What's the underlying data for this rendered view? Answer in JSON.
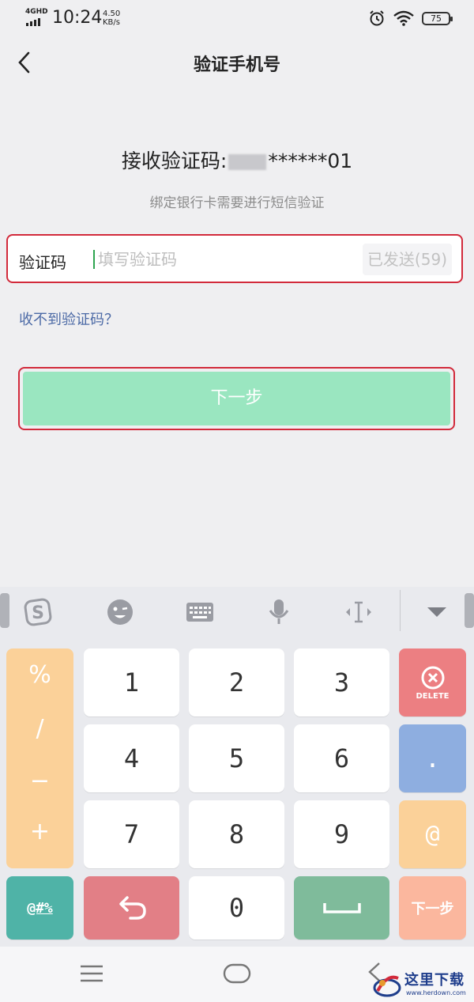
{
  "status_bar": {
    "network": "4GHD",
    "time": "10:24",
    "speed_value": "4.50",
    "speed_unit": "KB/s",
    "battery": "75"
  },
  "nav": {
    "title": "验证手机号"
  },
  "main": {
    "receive_label": "接收验证码:",
    "receive_number_suffix": "******01",
    "hint": "绑定银行卡需要进行短信验证",
    "code_label": "验证码",
    "code_placeholder": "填写验证码",
    "resend_label": "已发送(59)",
    "no_code_link": "收不到验证码？",
    "next_label": "下一步"
  },
  "keyboard": {
    "symbols": [
      "%",
      "/",
      "−",
      "+"
    ],
    "rows": [
      [
        "1",
        "2",
        "3"
      ],
      [
        "4",
        "5",
        "6"
      ],
      [
        "7",
        "8",
        "9"
      ]
    ],
    "zero": "0",
    "delete_label": "DELETE",
    "dot": ".",
    "at": "@",
    "symbol_key": "@#%",
    "next_key": "下一步"
  },
  "watermark": {
    "text": "这里下载",
    "url": "www.herdown.com"
  },
  "colors": {
    "accent_green": "#9ae6c0",
    "highlight_red": "#d22a3b",
    "link_blue": "#4c6aa6"
  }
}
